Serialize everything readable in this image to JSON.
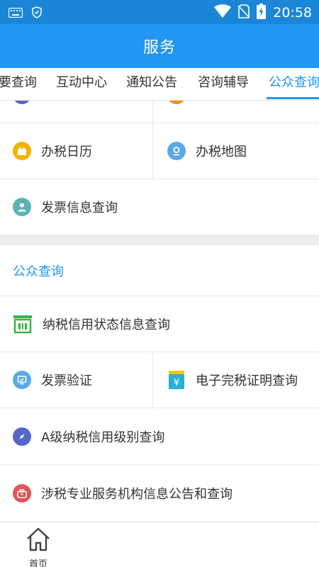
{
  "status_bar": {
    "time": "20:58",
    "icons": [
      "keyboard-icon",
      "shield-icon",
      "wifi-icon",
      "no-sim-icon",
      "battery-charging-icon"
    ]
  },
  "app_bar": {
    "title": "服务"
  },
  "tabs": [
    {
      "label": "要查询",
      "active": false
    },
    {
      "label": "互动中心",
      "active": false
    },
    {
      "label": "通知公告",
      "active": false
    },
    {
      "label": "咨询辅导",
      "active": false
    },
    {
      "label": "公众查询",
      "active": true
    }
  ],
  "services": {
    "tax_calendar": {
      "label": "办税日历",
      "icon": "calendar-icon",
      "color": "#f0b400"
    },
    "tax_map": {
      "label": "办税地图",
      "icon": "map-pin-icon",
      "color": "#5aa9e6"
    },
    "invoice_info": {
      "label": "发票信息查询",
      "icon": "person-icon",
      "color": "#5cb3b3"
    }
  },
  "public_query": {
    "title": "公众查询",
    "credit_status": {
      "label": "纳税信用状态信息查询",
      "icon": "building-icon",
      "color": "#3cb043"
    },
    "invoice_verify": {
      "label": "发票验证",
      "icon": "monitor-icon",
      "color": "#5aa9e6"
    },
    "tax_cert": {
      "label": "电子完税证明查询",
      "icon": "yen-card-icon",
      "color": "#2ab0d8"
    },
    "a_credit": {
      "label": "A级纳税信用级别查询",
      "icon": "compass-icon",
      "color": "#5565c8"
    },
    "agency_info": {
      "label": "涉税专业服务机构信息公告和查询",
      "icon": "briefcase-icon",
      "color": "#e05555"
    }
  },
  "bottom_nav": {
    "home_label": "首页"
  }
}
